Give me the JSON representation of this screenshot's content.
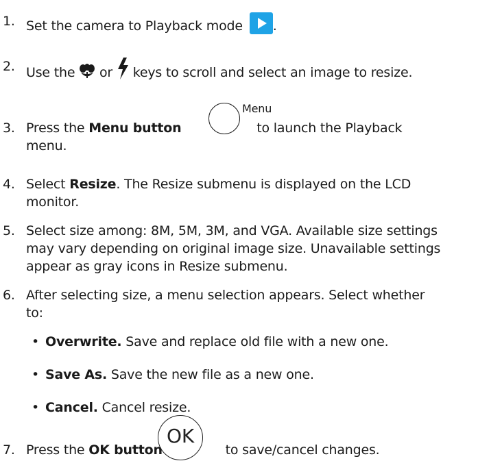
{
  "steps": [
    {
      "num": "1.",
      "pre": "Set the camera to Playback mode ",
      "post": "."
    },
    {
      "num": "2.",
      "pre": "Use the ",
      "mid": " or ",
      "post": " keys to scroll and select an image to resize."
    },
    {
      "num": "3.",
      "pre": "Press the ",
      "bold": "Menu button",
      "icon_label": "Menu",
      "post": " to launch the Playback",
      "line2": "menu."
    },
    {
      "num": "4.",
      "pre": "Select ",
      "bold": "Resize",
      "post": ". The Resize submenu is displayed on the LCD",
      "line2": "monitor."
    },
    {
      "num": "5.",
      "line1": "Select size among: 8M, 5M, 3M, and VGA. Available size settings",
      "line2": "may vary depending on original image size. Unavailable settings",
      "line3": "appear as gray icons in Resize submenu."
    },
    {
      "num": "6.",
      "line1": "After selecting size, a menu selection appears. Select whether",
      "line2": "to:"
    },
    {
      "num": "7.",
      "pre": "Press the ",
      "bold": "OK button",
      "icon_label": "OK",
      "post": " to save/cancel changes."
    }
  ],
  "bullets": [
    {
      "dot": "•",
      "bold": "Overwrite.",
      "text": " Save and replace old file with a new one."
    },
    {
      "dot": "•",
      "bold": "Save As.",
      "text": " Save the new file as a new one."
    },
    {
      "dot": "•",
      "bold": "Cancel.",
      "text": " Cancel resize."
    }
  ],
  "icons": {
    "playback": "play-icon",
    "macro": "flower-icon",
    "flash": "lightning-icon",
    "menu": "menu-button-icon",
    "ok": "ok-button-icon",
    "playback_color": "#1fa3e6"
  }
}
